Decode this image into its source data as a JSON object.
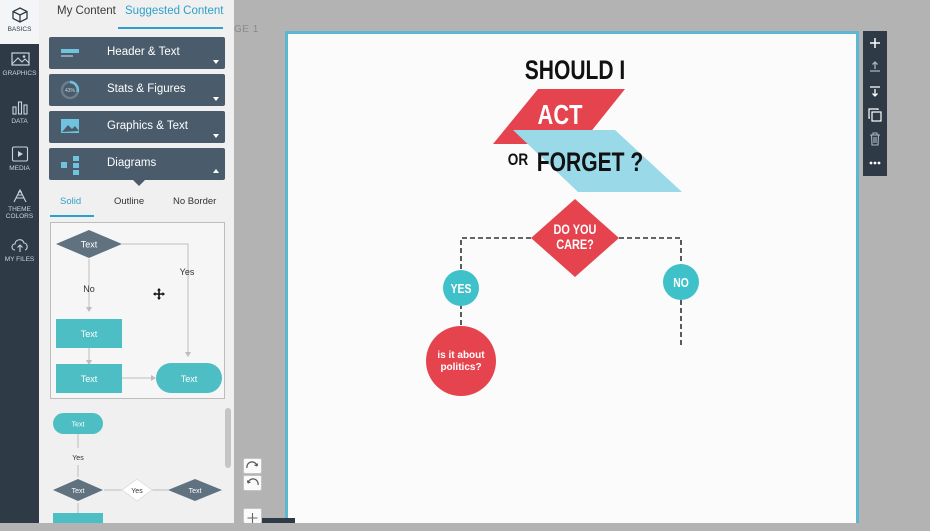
{
  "rail": {
    "items": [
      {
        "label": "BASICS",
        "icon": "cube-icon"
      },
      {
        "label": "GRAPHICS",
        "icon": "image-icon"
      },
      {
        "label": "DATA",
        "icon": "bar-chart-icon"
      },
      {
        "label": "MEDIA",
        "icon": "play-icon"
      },
      {
        "label": "THEME",
        "label2": "COLORS",
        "icon": "palette-icon"
      },
      {
        "label": "MY FILES",
        "icon": "cloud-upload-icon"
      }
    ]
  },
  "panel": {
    "tabs": [
      "My Content",
      "Suggested Content"
    ],
    "categories": [
      "Header & Text",
      "Stats & Figures",
      "Graphics & Text",
      "Diagrams"
    ],
    "stats_icon_text": "43%",
    "style_tabs": [
      "Solid",
      "Outline",
      "No Border"
    ],
    "thumb1": {
      "diamond": "Text",
      "no": "No",
      "yes": "Yes",
      "box1": "Text",
      "box2": "Text",
      "pill": "Text"
    },
    "thumb2": {
      "pill": "Text",
      "yes": "Yes",
      "d1": "Text",
      "d2": "Yes",
      "d3": "Text"
    }
  },
  "workspace": {
    "page_label": "GE 1"
  },
  "canvas": {
    "title_line1": "SHOULD I",
    "act": "ACT",
    "or": "OR",
    "forget": "FORGET ?",
    "care_line1": "DO YOU",
    "care_line2": "CARE?",
    "yes": "YES",
    "no": "NO",
    "politics_line1": "is it about",
    "politics_line2": "politics?"
  },
  "colors": {
    "red": "#e5444f",
    "teal": "#3fc1c9",
    "light_blue": "#9ad9e8",
    "dark": "#2e3b47",
    "accent": "#2ea0c9"
  }
}
